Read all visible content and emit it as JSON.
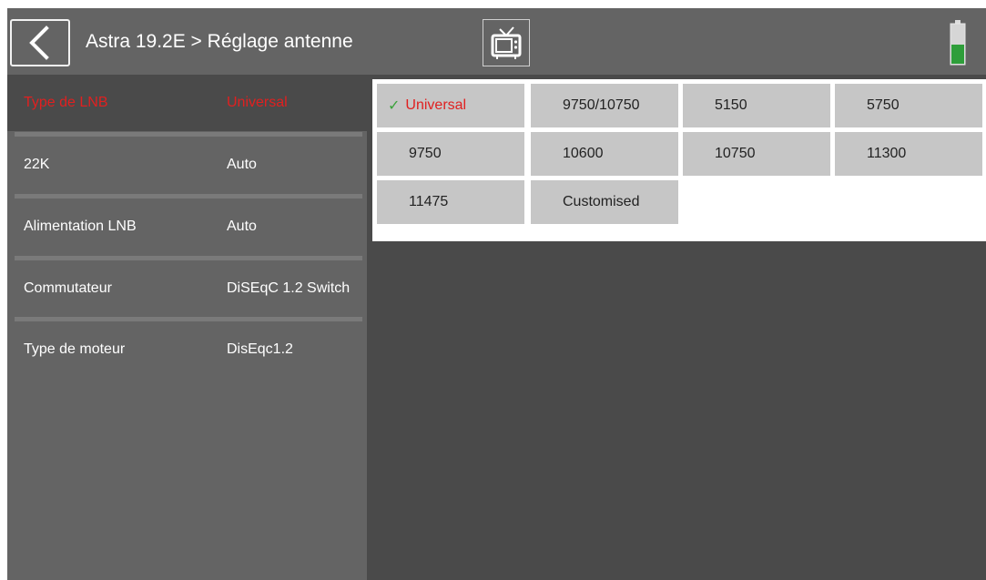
{
  "header": {
    "back_icon": "chevron-left-icon",
    "title": "Astra 19.2E > Réglage antenne",
    "tv_icon": "tv-icon",
    "battery_icon": "battery-icon"
  },
  "settings": [
    {
      "label": "Type de LNB",
      "value": "Universal",
      "selected": true
    },
    {
      "label": "22K",
      "value": "Auto"
    },
    {
      "label": "Alimentation LNB",
      "value": "Auto"
    },
    {
      "label": "Commutateur",
      "value": "DiSEqC 1.2 Switch"
    },
    {
      "label": "Type de moteur",
      "value": "DisEqc1.2"
    }
  ],
  "lnb_options": [
    {
      "label": "Universal",
      "selected": true
    },
    {
      "label": "9750/10750"
    },
    {
      "label": "5150"
    },
    {
      "label": "5750"
    },
    {
      "label": "9750"
    },
    {
      "label": "10600"
    },
    {
      "label": "10750"
    },
    {
      "label": "11300"
    },
    {
      "label": "11475"
    },
    {
      "label": "Customised"
    }
  ],
  "colors": {
    "selected_text": "#e02020",
    "check": "#3aa23a",
    "battery_fill": "#2e9e3a"
  }
}
